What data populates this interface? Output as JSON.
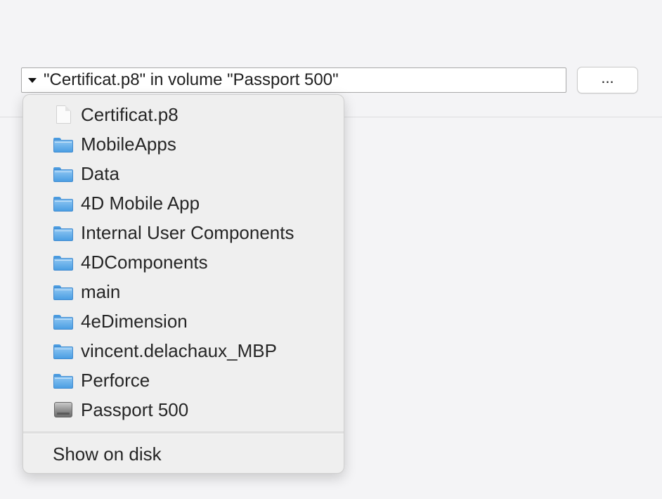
{
  "path_popup": {
    "value": "\"Certificat.p8\" in volume \"Passport 500\""
  },
  "browse_button": {
    "label": "..."
  },
  "menu": {
    "items": [
      {
        "label": "Certificat.p8",
        "icon": "document-icon"
      },
      {
        "label": "MobileApps",
        "icon": "folder-icon"
      },
      {
        "label": "Data",
        "icon": "folder-icon"
      },
      {
        "label": "4D Mobile App",
        "icon": "folder-icon"
      },
      {
        "label": "Internal User Components",
        "icon": "folder-icon"
      },
      {
        "label": "4DComponents",
        "icon": "folder-icon"
      },
      {
        "label": "main",
        "icon": "folder-icon"
      },
      {
        "label": "4eDimension",
        "icon": "folder-icon"
      },
      {
        "label": "vincent.delachaux_MBP",
        "icon": "folder-icon"
      },
      {
        "label": "Perforce",
        "icon": "folder-icon"
      },
      {
        "label": "Passport 500",
        "icon": "disk-icon"
      }
    ],
    "show_on_disk": "Show on disk"
  },
  "colors": {
    "background": "#f4f4f6",
    "menu_background": "#efefef",
    "folder_blue": "#4b9ee3"
  }
}
